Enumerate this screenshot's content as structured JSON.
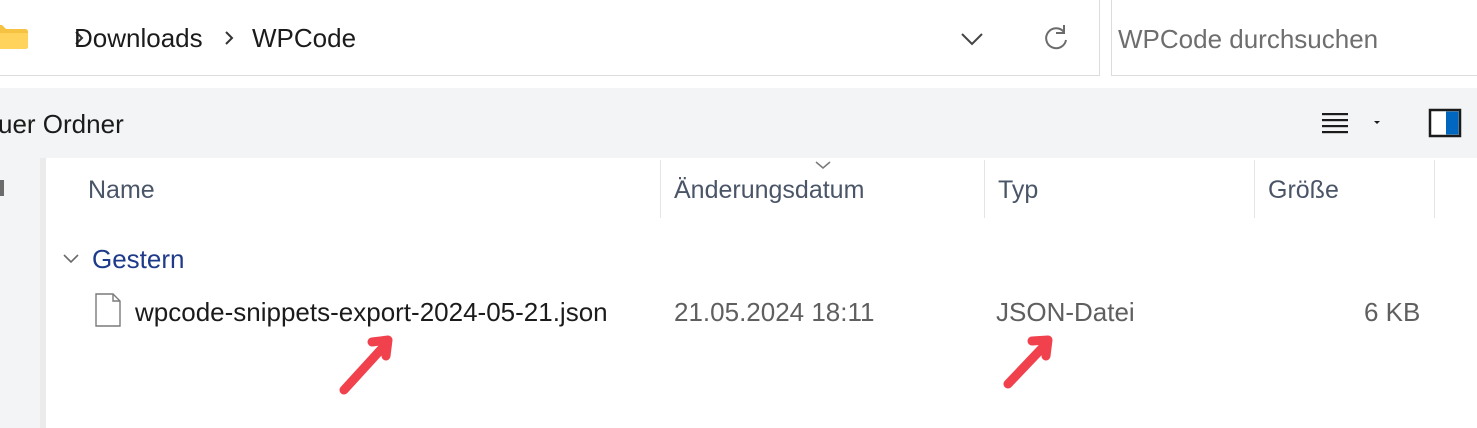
{
  "address_bar": {
    "breadcrumb": [
      "Downloads",
      "WPCode"
    ],
    "folder_icon": "folder-icon",
    "separator_icon": "chevron-right-icon",
    "history_icon": "chevron-down-icon",
    "refresh_icon": "refresh-icon"
  },
  "search": {
    "placeholder": "WPCode durchsuchen",
    "value": ""
  },
  "command_bar": {
    "new_folder_label": "uer Ordner",
    "view_icon": "list-view-icon",
    "view_dropdown_icon": "caret-down-icon",
    "details_pane_icon": "details-pane-icon"
  },
  "columns": {
    "name": "Name",
    "modified": "Änderungsdatum",
    "type": "Typ",
    "size": "Größe"
  },
  "groups": [
    {
      "label": "Gestern",
      "files": [
        {
          "name": "wpcode-snippets-export-2024-05-21.json",
          "modified": "21.05.2024 18:11",
          "type": "JSON-Datei",
          "size": "6 KB",
          "icon": "file-icon"
        }
      ]
    }
  ],
  "colors": {
    "group_label": "#1f3a8a",
    "annotation_arrow": "#f0414d",
    "command_bar_bg": "#f3f4f6",
    "details_pane_accent": "#0067c0"
  }
}
